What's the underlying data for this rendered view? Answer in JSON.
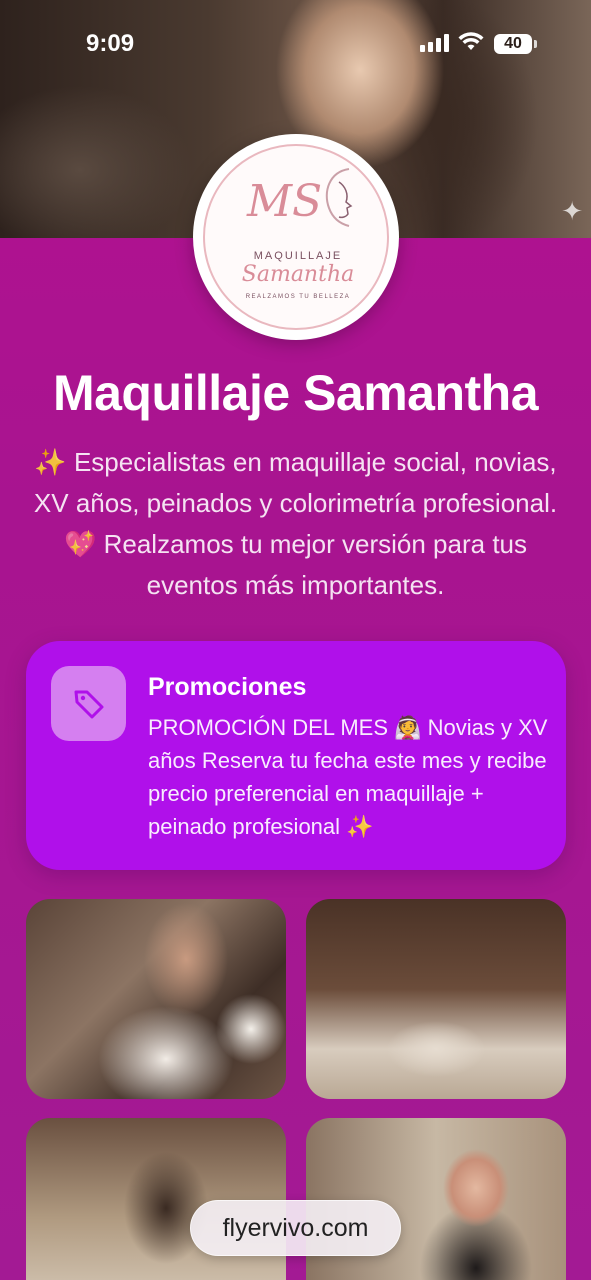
{
  "status_bar": {
    "time": "9:09",
    "battery": "40"
  },
  "logo": {
    "monogram": "MS",
    "line1": "MAQUILLAJE",
    "line2": "Samantha",
    "tagline": "REALZAMOS TU BELLEZA"
  },
  "profile": {
    "title": "Maquillaje Samantha",
    "bio": "✨ Especialistas en maquillaje social, novias, XV años, peinados y colorimetría profesional. 💖 Realzamos tu mejor versión para tus eventos más importantes."
  },
  "promo": {
    "icon": "tag-icon",
    "title": "Promociones",
    "text": "PROMOCIÓN DEL MES 👰 Novias y XV años Reserva tu fecha este mes y recibe precio preferencial en maquillaje + peinado profesional ✨"
  },
  "gallery": {
    "items": [
      {
        "name": "bride-makeup-photo"
      },
      {
        "name": "makeup-brushes-photo"
      },
      {
        "name": "studio-brushes-photo"
      },
      {
        "name": "artist-portrait-photo"
      }
    ]
  },
  "footer": {
    "brand": "flyervivo.com"
  },
  "colors": {
    "background": "#a81490",
    "promo_card": "#b010ea",
    "promo_icon_bg": "#d57ff0"
  }
}
